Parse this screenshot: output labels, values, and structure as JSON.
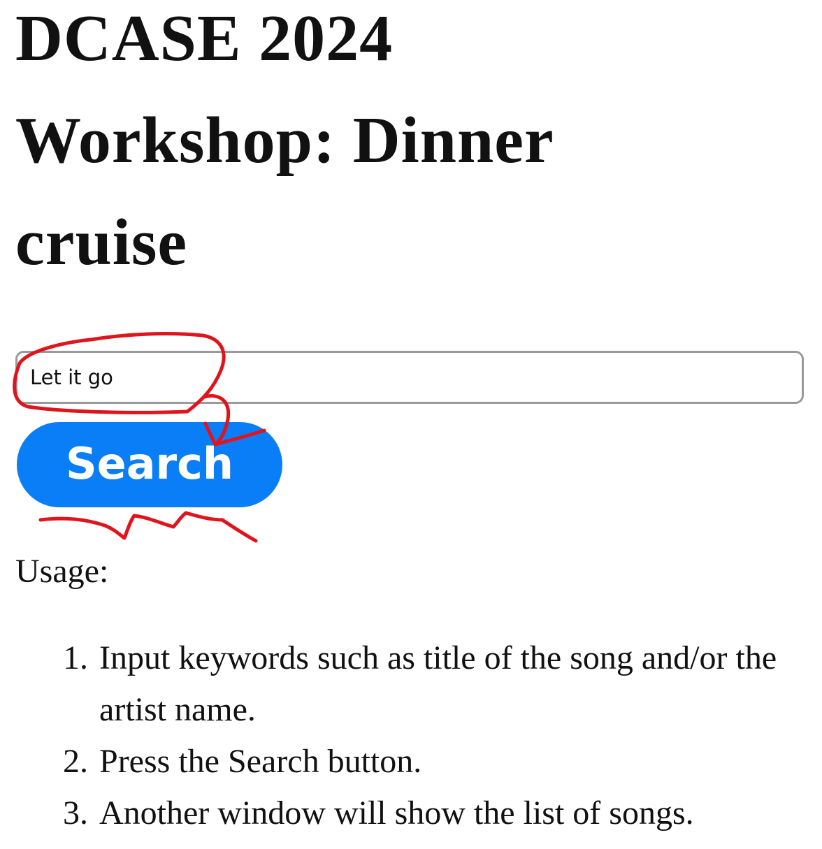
{
  "page": {
    "title": "DCASE 2024 Workshop: Dinner cruise"
  },
  "search": {
    "value": "Let it go",
    "button_label": "Search"
  },
  "usage": {
    "label": "Usage:",
    "steps": [
      {
        "num": "1.",
        "text": "Input keywords such as title of the song and/or the artist name."
      },
      {
        "num": "2.",
        "text": "Press the Search button."
      },
      {
        "num": "3.",
        "text": "Another window will show the list of songs."
      }
    ]
  },
  "annotation": {
    "color": "#e0141c"
  }
}
